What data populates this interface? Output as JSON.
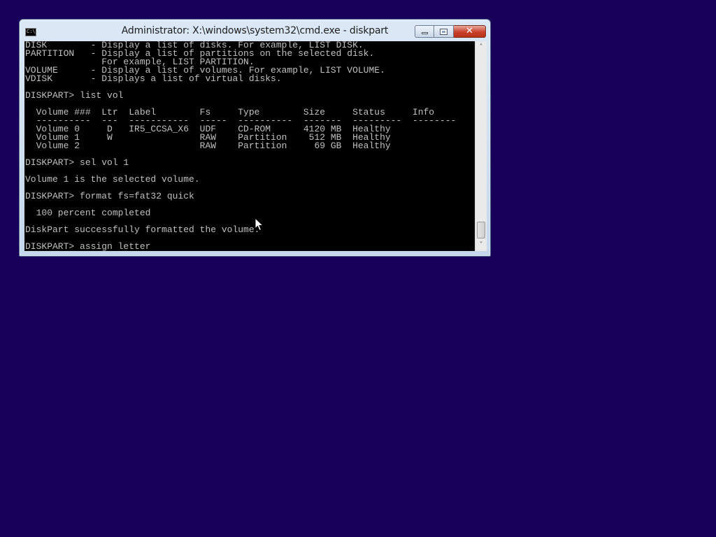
{
  "window": {
    "title": "Administrator: X:\\windows\\system32\\cmd.exe - diskpart",
    "icon_label": "C:\\.",
    "controls": {
      "minimize": "minimize-icon",
      "maximize": "maximize-icon",
      "close": "close-icon",
      "close_glyph": "✕"
    }
  },
  "console": {
    "lines": [
      "DISK        - Display a list of disks. For example, LIST DISK.",
      "PARTITION   - Display a list of partitions on the selected disk.",
      "              For example, LIST PARTITION.",
      "VOLUME      - Display a list of volumes. For example, LIST VOLUME.",
      "VDISK       - Displays a list of virtual disks.",
      "",
      "DISKPART> list vol",
      "",
      "  Volume ###  Ltr  Label        Fs     Type        Size     Status     Info",
      "  ----------  ---  -----------  -----  ----------  -------  ---------  --------",
      "  Volume 0     D   IR5_CCSA_X6  UDF    CD-ROM      4120 MB  Healthy",
      "  Volume 1     W                RAW    Partition    512 MB  Healthy",
      "  Volume 2                      RAW    Partition     69 GB  Healthy",
      "",
      "DISKPART> sel vol 1",
      "",
      "Volume 1 is the selected volume.",
      "",
      "DISKPART> format fs=fat32 quick",
      "",
      "  100 percent completed",
      "",
      "DiskPart successfully formatted the volume.",
      "",
      "DISKPART> assign letter"
    ],
    "colors": {
      "background": "#000000",
      "foreground": "#c0c0c0"
    }
  },
  "scrollbar": {
    "up_arrow": "˄",
    "down_arrow": "˅"
  },
  "desktop": {
    "background": "#18005a"
  }
}
